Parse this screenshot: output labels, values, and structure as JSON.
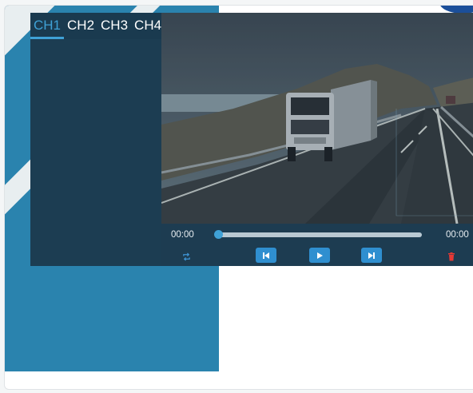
{
  "player": {
    "channels": [
      {
        "label": "CH1",
        "active": true
      },
      {
        "label": "CH2",
        "active": false
      },
      {
        "label": "CH3",
        "active": false
      },
      {
        "label": "CH4",
        "active": false
      }
    ],
    "controls": {
      "time_current": "00:00",
      "time_total": "00:00",
      "progress": 0,
      "prev_icon": "skip-previous-icon",
      "play_icon": "play-icon",
      "next_icon": "skip-next-icon",
      "loop_icon": "loop-icon",
      "delete_icon": "trash-icon"
    },
    "video_preview": "truck-on-highway"
  },
  "colors": {
    "accent": "#3fa1d6",
    "panel_dark": "#1c3d52",
    "background_blue": "#2a83ae",
    "delete_red": "#e53935"
  }
}
